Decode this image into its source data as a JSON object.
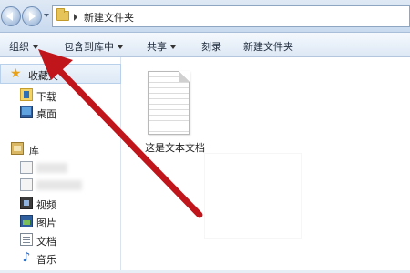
{
  "address_bar": {
    "path_label": "新建文件夹"
  },
  "toolbar": {
    "organize_label": "组织",
    "include_in_library_label": "包含到库中",
    "share_label": "共享",
    "burn_label": "刻录",
    "new_folder_label": "新建文件夹"
  },
  "nav_pane": {
    "favorites_label": "收藏夹",
    "favorites": [
      {
        "label": "下载",
        "icon": "download-folder-icon"
      },
      {
        "label": "桌面",
        "icon": "desktop-icon"
      }
    ],
    "libraries_label": "库",
    "libraries": [
      {
        "label": "视频",
        "icon": "video-library-icon"
      },
      {
        "label": "图片",
        "icon": "pictures-library-icon"
      },
      {
        "label": "文档",
        "icon": "documents-library-icon"
      },
      {
        "label": "音乐",
        "icon": "music-library-icon"
      }
    ]
  },
  "content": {
    "files": [
      {
        "name": "这是文本文档",
        "icon": "text-document-icon"
      }
    ]
  },
  "annotation": {
    "arrow_color": "#c0161b"
  }
}
